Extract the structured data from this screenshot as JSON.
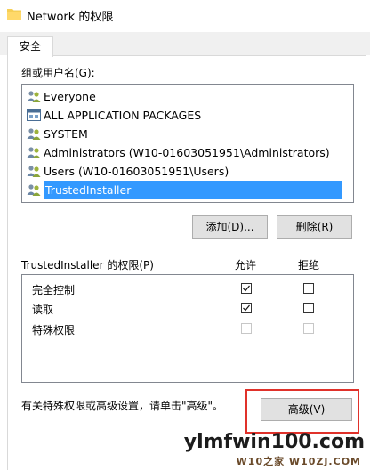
{
  "window": {
    "title": "Network 的权限"
  },
  "tabs": [
    {
      "label": "安全"
    }
  ],
  "group_section": {
    "label": "组或用户名(G):",
    "items": [
      {
        "name": "Everyone",
        "icon": "users-icon",
        "selected": false
      },
      {
        "name": "ALL APPLICATION PACKAGES",
        "icon": "app-packages-icon",
        "selected": false
      },
      {
        "name": "SYSTEM",
        "icon": "users-icon",
        "selected": false
      },
      {
        "name": "Administrators (W10-01603051951\\Administrators)",
        "icon": "users-icon",
        "selected": false
      },
      {
        "name": "Users (W10-01603051951\\Users)",
        "icon": "users-icon",
        "selected": false
      },
      {
        "name": "TrustedInstaller",
        "icon": "user-icon",
        "selected": true
      }
    ]
  },
  "buttons": {
    "add": "添加(D)...",
    "remove": "删除(R)",
    "advanced": "高级(V)"
  },
  "permissions": {
    "label": "TrustedInstaller 的权限(P)",
    "allow_header": "允许",
    "deny_header": "拒绝",
    "rows": [
      {
        "name": "完全控制",
        "allow": true,
        "deny": false,
        "disabled": false
      },
      {
        "name": "读取",
        "allow": true,
        "deny": false,
        "disabled": false
      },
      {
        "name": "特殊权限",
        "allow": false,
        "deny": false,
        "disabled": true
      }
    ]
  },
  "advanced_hint": "有关特殊权限或高级设置，请单击\"高级\"。",
  "watermark": {
    "main": "ylmfwin100.com",
    "sub": "W10之家 W10ZJ.COM"
  },
  "colors": {
    "selection": "#3399ff",
    "highlight_frame": "#e0312a",
    "button_face": "#e1e1e1"
  }
}
